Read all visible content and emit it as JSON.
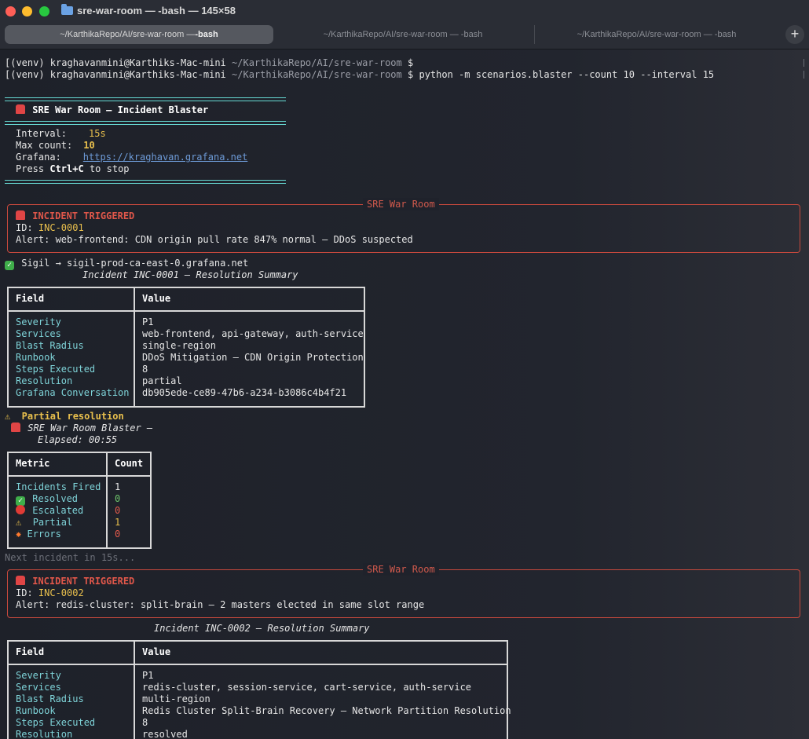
{
  "window": {
    "title": "sre-war-room — -bash — 145×58",
    "tabs": [
      {
        "path": "~/KarthikaRepo/AI/sre-war-room — ",
        "cmd": "-bash"
      },
      {
        "path": "~/KarthikaRepo/AI/sre-war-room — -bash"
      },
      {
        "path": "~/KarthikaRepo/AI/sre-war-room — -bash"
      }
    ],
    "new_tab_symbol": "+"
  },
  "prompt": {
    "venv": "(venv) kraghavanmini@Karthiks-Mac-mini",
    "dir": "~/KarthikaRepo/AI/sre-war-room",
    "symbol": "$",
    "command": "python -m scenarios.blaster --count 10 --interval 15"
  },
  "banner": {
    "title": "SRE War Room — Incident Blaster",
    "interval_label": "Interval:",
    "interval_value": "15s",
    "max_label": "Max count:",
    "max_value": "10",
    "grafana_label": "Grafana:",
    "grafana_url": "https://kraghavan.grafana.net",
    "press_1": "Press ",
    "press_key": "Ctrl+C",
    "press_2": " to stop"
  },
  "panel_title": "SRE War Room",
  "incident1": {
    "heading": "INCIDENT TRIGGERED",
    "id_label": "ID: ",
    "id": "INC-0001",
    "alert": "Alert: web-frontend: CDN origin pull rate 847% normal — DDoS suspected"
  },
  "sigil": "Sigil → sigil-prod-ca-east-0.grafana.net",
  "summary1": {
    "caption": "Incident INC-0001 — Resolution Summary",
    "col1": "Field",
    "col2": "Value",
    "rows": [
      {
        "field": "Severity",
        "value": "P1"
      },
      {
        "field": "Services",
        "value": "web-frontend, api-gateway, auth-service"
      },
      {
        "field": "Blast Radius",
        "value": "single-region"
      },
      {
        "field": "Runbook",
        "value": "DDoS Mitigation — CDN Origin Protection"
      },
      {
        "field": "Steps Executed",
        "value": "8"
      },
      {
        "field": "Resolution",
        "value": "partial"
      },
      {
        "field": "Grafana Conversation",
        "value": "db905ede-ce89-47b6-a234-b3086c4b4f21"
      }
    ]
  },
  "partial": "⚠  Partial resolution",
  "blaster": {
    "line1": "SRE War Room Blaster —",
    "line2": "Elapsed: 00:55"
  },
  "metrics": {
    "col1": "Metric",
    "col2": "Count",
    "rows": [
      {
        "metric": "Incidents Fired",
        "count": "1"
      },
      {
        "metric": "Resolved",
        "count": "0"
      },
      {
        "metric": "Escalated",
        "count": "0"
      },
      {
        "metric": "Partial",
        "count": "1"
      },
      {
        "metric": "Errors",
        "count": "0"
      }
    ]
  },
  "next": "Next incident in 15s...",
  "incident2": {
    "heading": "INCIDENT TRIGGERED",
    "id_label": "ID: ",
    "id": "INC-0002",
    "alert": "Alert: redis-cluster: split-brain — 2 masters elected in same slot range"
  },
  "summary2": {
    "caption": "Incident INC-0002 — Resolution Summary",
    "col1": "Field",
    "col2": "Value",
    "rows": [
      {
        "field": "Severity",
        "value": "P1"
      },
      {
        "field": "Services",
        "value": "redis-cluster, session-service, cart-service, auth-service"
      },
      {
        "field": "Blast Radius",
        "value": "multi-region"
      },
      {
        "field": "Runbook",
        "value": "Redis Cluster Split-Brain Recovery — Network Partition Resolution"
      },
      {
        "field": "Steps Executed",
        "value": "8"
      },
      {
        "field": "Resolution",
        "value": "resolved"
      }
    ]
  }
}
